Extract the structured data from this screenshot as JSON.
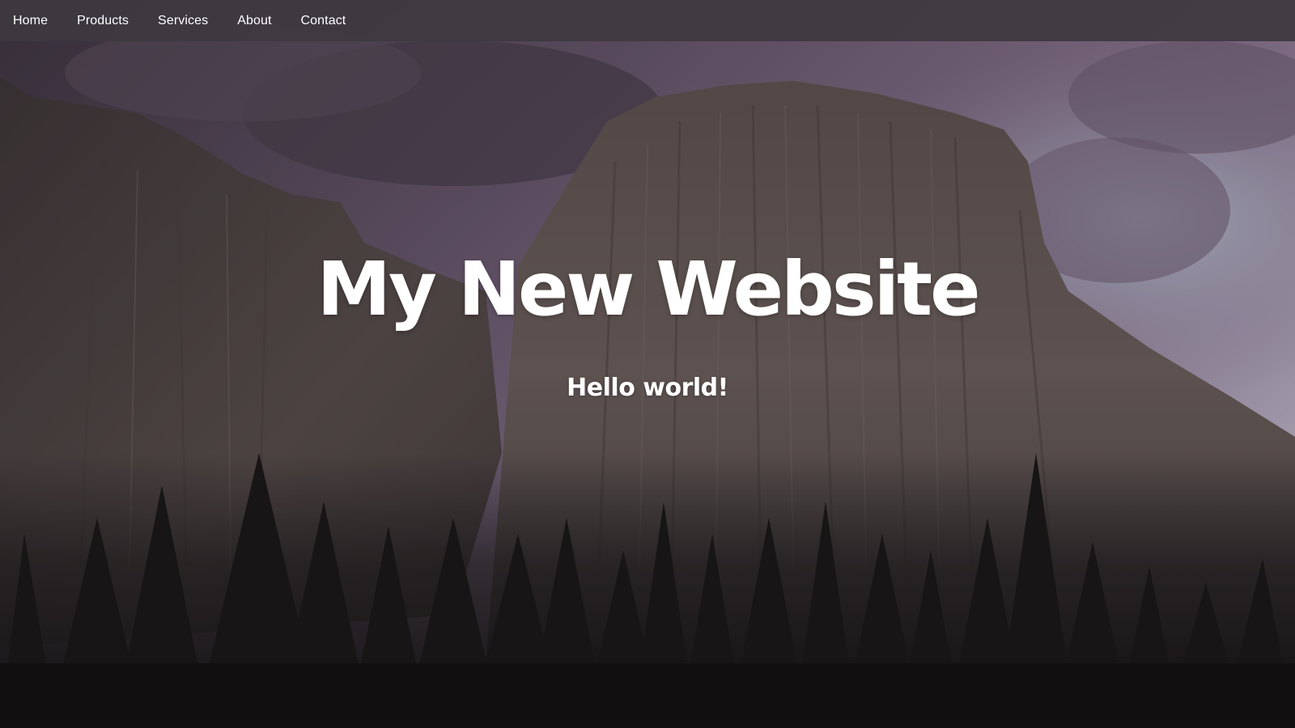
{
  "nav": {
    "items": [
      {
        "label": "Home"
      },
      {
        "label": "Products"
      },
      {
        "label": "Services"
      },
      {
        "label": "About"
      },
      {
        "label": "Contact"
      }
    ]
  },
  "hero": {
    "title": "My New Website",
    "subtitle": "Hello world!",
    "background_image": "mountain-cliff-forest-photo"
  },
  "colors": {
    "navbar_bg": "#3e3840",
    "text": "#ffffff",
    "sky": "#5a4a5e",
    "rock": "#5e5350",
    "forest": "#1c1a1b"
  }
}
